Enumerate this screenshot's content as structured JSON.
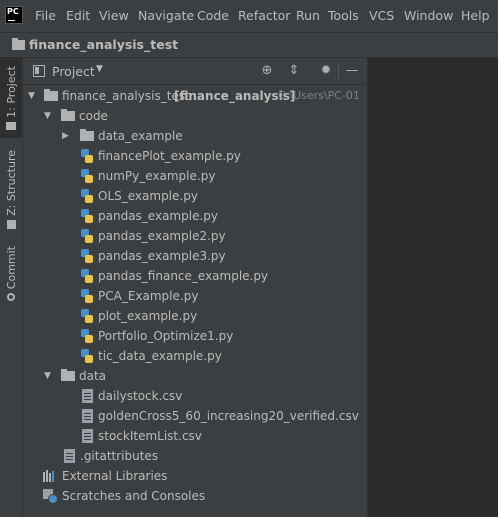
{
  "app": {
    "logo_text": "PC",
    "logo_icon": "pycharm-logo"
  },
  "menu": [
    "File",
    "Edit",
    "View",
    "Navigate",
    "Code",
    "Refactor",
    "Run",
    "Tools",
    "VCS",
    "Window",
    "Help"
  ],
  "navbar": {
    "project_name": "finance_analysis_test"
  },
  "side_tabs": {
    "project": "1: Project",
    "structure": "Z: Structure",
    "commit": "Commit"
  },
  "panel": {
    "title": "Project",
    "buttons": [
      "locate-icon",
      "collapse-all-icon",
      "settings-icon",
      "hide-icon"
    ]
  },
  "tree": {
    "root": {
      "name": "finance_analysis_test",
      "module": "[finance_analysis]",
      "path": "C:\\Users\\PC-01"
    },
    "code_folder": "code",
    "data_example_folder": "data_example",
    "code_files": [
      "financePlot_example.py",
      "numPy_example.py",
      "OLS_example.py",
      "pandas_example.py",
      "pandas_example2.py",
      "pandas_example3.py",
      "pandas_finance_example.py",
      "PCA_Example.py",
      "plot_example.py",
      "Portfolio_Optimize1.py",
      "tic_data_example.py"
    ],
    "data_folder": "data",
    "data_files": [
      "dailystock.csv",
      "goldenCross5_60_increasing20_verified.csv",
      "stockItemList.csv"
    ],
    "gitattributes": ".gitattributes",
    "external_libraries": "External Libraries",
    "scratches": "Scratches and Consoles"
  },
  "colors": {
    "background": "#3c3f41",
    "editor": "#2b2b2b",
    "text": "#bbbbbb",
    "python_blue": "#4a90c8",
    "python_yellow": "#e8c547"
  }
}
